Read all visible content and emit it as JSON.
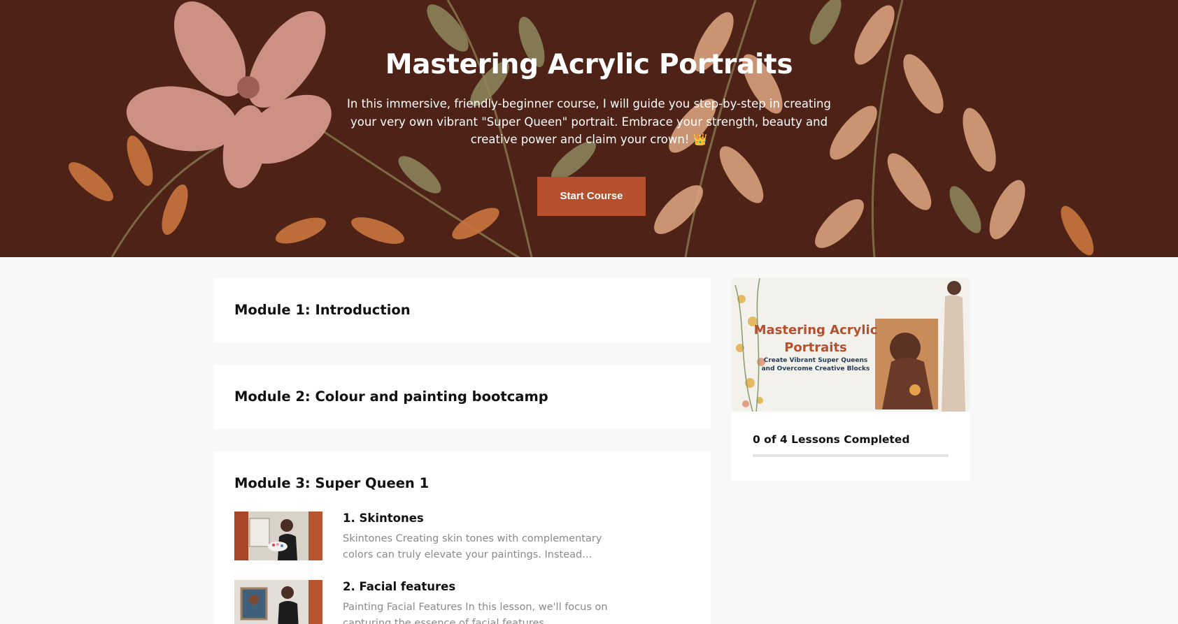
{
  "hero": {
    "title": "Mastering Acrylic Portraits",
    "description": "In this immersive, friendly-beginner course, I will guide you step-by-step in creating your very own vibrant \"Super Queen\" portrait. Embrace your strength, beauty and creative power and claim your crown! 👑",
    "start_button": "Start Course",
    "background_color": "#4e2216"
  },
  "modules": [
    {
      "title": "Module 1: Introduction"
    },
    {
      "title": "Module 2: Colour and painting bootcamp"
    },
    {
      "title": "Module 3: Super Queen 1",
      "lessons": [
        {
          "title": "1. Skintones",
          "excerpt": "Skintones Creating skin tones with complementary colors can truly elevate your paintings. Instead..."
        },
        {
          "title": "2. Facial features",
          "excerpt": "Painting Facial Features In this lesson, we'll focus on capturing the essence of facial features..."
        }
      ]
    }
  ],
  "sidebar": {
    "cover_title": "Mastering Acrylic Portraits",
    "cover_subtitle": "Create Vibrant Super Queens and Overcome Creative Blocks",
    "progress_label": "0 of 4 Lessons Completed",
    "lessons_completed": 0,
    "lessons_total": 4
  },
  "colors": {
    "accent": "#b4502d",
    "page_background": "#f8f8f8"
  }
}
